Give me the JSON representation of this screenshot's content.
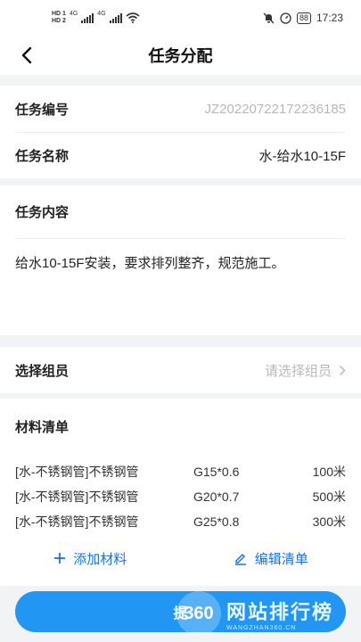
{
  "status_bar": {
    "hd1": "HD 1",
    "hd2": "HD 2",
    "net1": "4G",
    "net2": "4G",
    "battery": "88",
    "time": "17:23"
  },
  "nav": {
    "title": "任务分配"
  },
  "task": {
    "number_label": "任务编号",
    "number_value": "JZ20220722172236185",
    "name_label": "任务名称",
    "name_value": "水-给水10-15F"
  },
  "content": {
    "title": "任务内容",
    "text": "给水10-15F安装，要求排列整齐，规范施工。"
  },
  "group": {
    "label": "选择组员",
    "placeholder": "请选择组员"
  },
  "materials": {
    "title": "材料清单",
    "items": [
      {
        "name": "[水-不锈钢管]不锈钢管",
        "spec": "G15*0.6",
        "qty": "100米"
      },
      {
        "name": "[水-不锈钢管]不锈钢管",
        "spec": "G20*0.7",
        "qty": "500米"
      },
      {
        "name": "[水-不锈钢管]不锈钢管",
        "spec": "G25*0.8",
        "qty": "300米"
      }
    ],
    "add_label": "添加材料",
    "edit_label": "编辑清单"
  },
  "submit": {
    "label": "提"
  },
  "watermark": {
    "logo": "360",
    "text": "网站排行榜",
    "sub": "WANGZHAN360.CN"
  },
  "colors": {
    "accent": "#2196f3",
    "link": "#1a73e8"
  }
}
